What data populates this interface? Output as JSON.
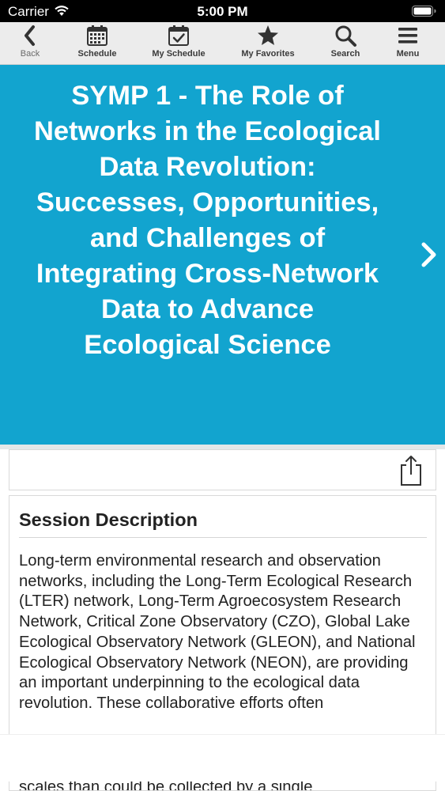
{
  "status_bar": {
    "carrier": "Carrier",
    "time": "5:00 PM"
  },
  "toolbar": {
    "back": {
      "label": "Back",
      "icon": "chevron-left-icon"
    },
    "schedule": {
      "label": "Schedule",
      "icon": "calendar-icon"
    },
    "my_schedule": {
      "label": "My Schedule",
      "icon": "calendar-check-icon"
    },
    "my_favorites": {
      "label": "My Favorites",
      "icon": "star-icon"
    },
    "search": {
      "label": "Search",
      "icon": "search-icon"
    },
    "menu": {
      "label": "Menu",
      "icon": "hamburger-menu-icon"
    }
  },
  "session": {
    "title": "SYMP 1 - The Role of Networks in the Ecological Data Revolution: Successes, Opportunities, and Challenges of Integrating Cross-Network Data to Advance Ecological Science",
    "hero_color": "#12a4cf"
  },
  "description": {
    "heading": "Session Description",
    "text": "Long-term environmental research and observation networks, including the Long-Term Ecological Research (LTER) network, Long-Term Agroecosystem Research Network, Critical Zone Observatory (CZO), Global Lake Ecological Observatory Network (GLEON), and National Ecological Observatory Network (NEON), are providing an important underpinning to the ecological data revolution. These collaborative efforts often",
    "partial_line": "scales than could be collected by a single"
  }
}
